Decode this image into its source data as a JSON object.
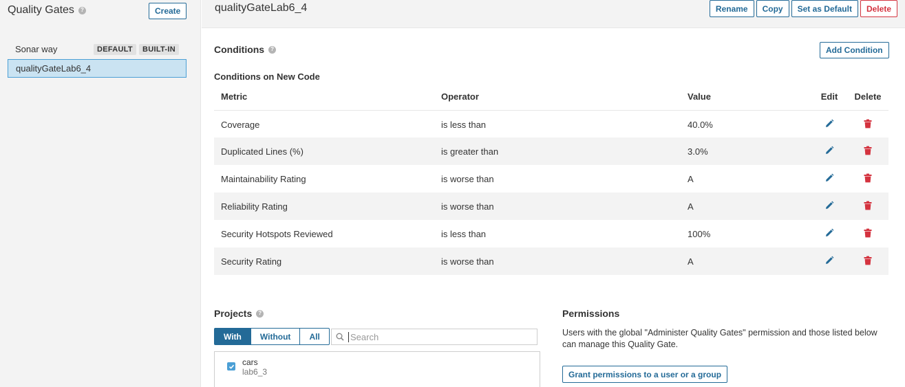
{
  "sidebar": {
    "title": "Quality Gates",
    "create_label": "Create",
    "gates": [
      {
        "name": "Sonar way",
        "badges": [
          "DEFAULT",
          "BUILT-IN"
        ]
      },
      {
        "name": "qualityGateLab6_4",
        "selected": true
      }
    ]
  },
  "header": {
    "gate_name": "qualityGateLab6_4",
    "actions": {
      "rename": "Rename",
      "copy": "Copy",
      "set_default": "Set as Default",
      "delete": "Delete"
    }
  },
  "conditions": {
    "title": "Conditions",
    "add_label": "Add Condition",
    "subtitle": "Conditions on New Code",
    "columns": {
      "metric": "Metric",
      "operator": "Operator",
      "value": "Value",
      "edit": "Edit",
      "delete": "Delete"
    },
    "rows": [
      {
        "metric": "Coverage",
        "operator": "is less than",
        "value": "40.0%"
      },
      {
        "metric": "Duplicated Lines (%)",
        "operator": "is greater than",
        "value": "3.0%"
      },
      {
        "metric": "Maintainability Rating",
        "operator": "is worse than",
        "value": "A"
      },
      {
        "metric": "Reliability Rating",
        "operator": "is worse than",
        "value": "A"
      },
      {
        "metric": "Security Hotspots Reviewed",
        "operator": "is less than",
        "value": "100%"
      },
      {
        "metric": "Security Rating",
        "operator": "is worse than",
        "value": "A"
      }
    ]
  },
  "projects": {
    "title": "Projects",
    "filters": [
      "With",
      "Without",
      "All"
    ],
    "active_filter": "With",
    "search_placeholder": "Search",
    "items": [
      {
        "name": "cars",
        "key": "lab6_3",
        "checked": true
      }
    ]
  },
  "permissions": {
    "title": "Permissions",
    "text": "Users with the global \"Administer Quality Gates\" permission and those listed below can manage this Quality Gate.",
    "grant_label": "Grant permissions to a user or a group"
  },
  "colors": {
    "primary": "#236a97",
    "danger": "#d4333f",
    "selected_bg": "#cae3f2",
    "selected_border": "#4b9fd5"
  },
  "icons": {
    "help": "help-icon",
    "edit": "pencil-icon",
    "delete": "trash-icon",
    "search": "search-icon",
    "check": "checkbox-checked-icon"
  }
}
